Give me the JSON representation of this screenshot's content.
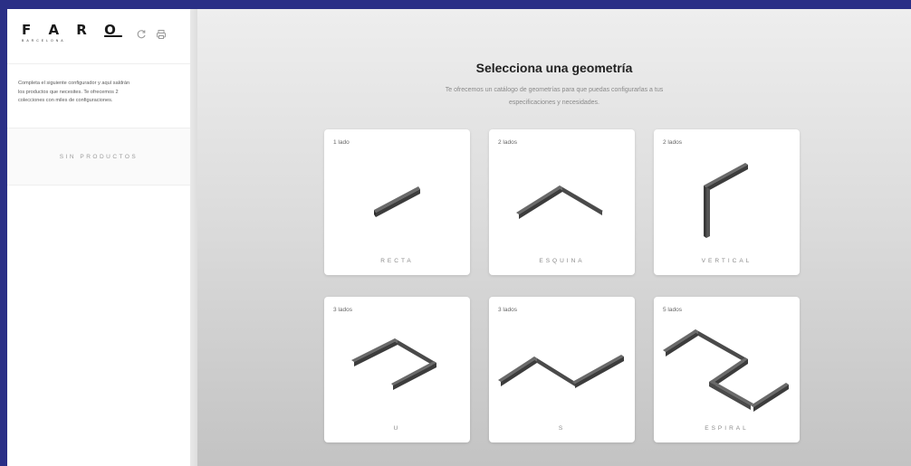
{
  "sidebar": {
    "logo_text": "FARO",
    "logo_subtext": "BARCELONA",
    "description_lines": [
      "Completa el siguiente configurador y aquí saldrán",
      "los productos que necesites. Te ofrecemos 2",
      "colecciones con miles de configuraciones."
    ],
    "no_products_label": "SIN PRODUCTOS",
    "icons": [
      "refresh-icon",
      "print-icon"
    ]
  },
  "main": {
    "title": "Selecciona una geometría",
    "subtitle": "Te ofrecemos un catálogo de geometrías para que puedas configurarlas a tus especificaciones y necesidades."
  },
  "colors": {
    "background": "#2a2f86",
    "bar_top": "#6a6a6a",
    "bar_side": "#3a3a3a"
  },
  "cards": [
    {
      "sides": "1 lado",
      "name": "RECTA",
      "icon": "straight-geometry-icon"
    },
    {
      "sides": "2 lados",
      "name": "ESQUINA",
      "icon": "corner-geometry-icon"
    },
    {
      "sides": "2 lados",
      "name": "VERTICAL",
      "icon": "vertical-geometry-icon"
    },
    {
      "sides": "3 lados",
      "name": "U",
      "icon": "u-geometry-icon"
    },
    {
      "sides": "3 lados",
      "name": "S",
      "icon": "s-geometry-icon"
    },
    {
      "sides": "5 lados",
      "name": "ESPIRAL",
      "icon": "spiral-geometry-icon"
    }
  ]
}
